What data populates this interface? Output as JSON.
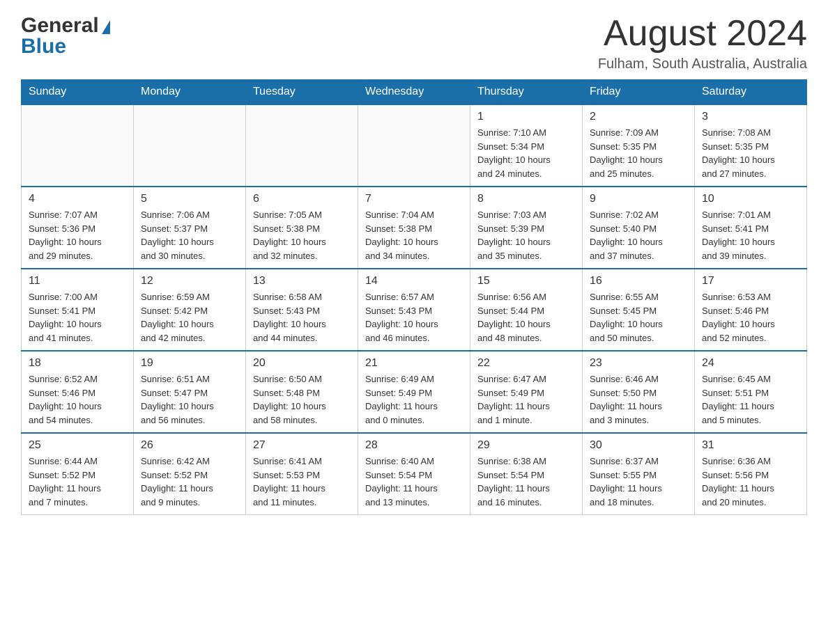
{
  "header": {
    "month_title": "August 2024",
    "location": "Fulham, South Australia, Australia",
    "logo_general": "General",
    "logo_blue": "Blue"
  },
  "weekdays": [
    "Sunday",
    "Monday",
    "Tuesday",
    "Wednesday",
    "Thursday",
    "Friday",
    "Saturday"
  ],
  "weeks": [
    {
      "days": [
        {
          "number": "",
          "info": ""
        },
        {
          "number": "",
          "info": ""
        },
        {
          "number": "",
          "info": ""
        },
        {
          "number": "",
          "info": ""
        },
        {
          "number": "1",
          "info": "Sunrise: 7:10 AM\nSunset: 5:34 PM\nDaylight: 10 hours\nand 24 minutes."
        },
        {
          "number": "2",
          "info": "Sunrise: 7:09 AM\nSunset: 5:35 PM\nDaylight: 10 hours\nand 25 minutes."
        },
        {
          "number": "3",
          "info": "Sunrise: 7:08 AM\nSunset: 5:35 PM\nDaylight: 10 hours\nand 27 minutes."
        }
      ]
    },
    {
      "days": [
        {
          "number": "4",
          "info": "Sunrise: 7:07 AM\nSunset: 5:36 PM\nDaylight: 10 hours\nand 29 minutes."
        },
        {
          "number": "5",
          "info": "Sunrise: 7:06 AM\nSunset: 5:37 PM\nDaylight: 10 hours\nand 30 minutes."
        },
        {
          "number": "6",
          "info": "Sunrise: 7:05 AM\nSunset: 5:38 PM\nDaylight: 10 hours\nand 32 minutes."
        },
        {
          "number": "7",
          "info": "Sunrise: 7:04 AM\nSunset: 5:38 PM\nDaylight: 10 hours\nand 34 minutes."
        },
        {
          "number": "8",
          "info": "Sunrise: 7:03 AM\nSunset: 5:39 PM\nDaylight: 10 hours\nand 35 minutes."
        },
        {
          "number": "9",
          "info": "Sunrise: 7:02 AM\nSunset: 5:40 PM\nDaylight: 10 hours\nand 37 minutes."
        },
        {
          "number": "10",
          "info": "Sunrise: 7:01 AM\nSunset: 5:41 PM\nDaylight: 10 hours\nand 39 minutes."
        }
      ]
    },
    {
      "days": [
        {
          "number": "11",
          "info": "Sunrise: 7:00 AM\nSunset: 5:41 PM\nDaylight: 10 hours\nand 41 minutes."
        },
        {
          "number": "12",
          "info": "Sunrise: 6:59 AM\nSunset: 5:42 PM\nDaylight: 10 hours\nand 42 minutes."
        },
        {
          "number": "13",
          "info": "Sunrise: 6:58 AM\nSunset: 5:43 PM\nDaylight: 10 hours\nand 44 minutes."
        },
        {
          "number": "14",
          "info": "Sunrise: 6:57 AM\nSunset: 5:43 PM\nDaylight: 10 hours\nand 46 minutes."
        },
        {
          "number": "15",
          "info": "Sunrise: 6:56 AM\nSunset: 5:44 PM\nDaylight: 10 hours\nand 48 minutes."
        },
        {
          "number": "16",
          "info": "Sunrise: 6:55 AM\nSunset: 5:45 PM\nDaylight: 10 hours\nand 50 minutes."
        },
        {
          "number": "17",
          "info": "Sunrise: 6:53 AM\nSunset: 5:46 PM\nDaylight: 10 hours\nand 52 minutes."
        }
      ]
    },
    {
      "days": [
        {
          "number": "18",
          "info": "Sunrise: 6:52 AM\nSunset: 5:46 PM\nDaylight: 10 hours\nand 54 minutes."
        },
        {
          "number": "19",
          "info": "Sunrise: 6:51 AM\nSunset: 5:47 PM\nDaylight: 10 hours\nand 56 minutes."
        },
        {
          "number": "20",
          "info": "Sunrise: 6:50 AM\nSunset: 5:48 PM\nDaylight: 10 hours\nand 58 minutes."
        },
        {
          "number": "21",
          "info": "Sunrise: 6:49 AM\nSunset: 5:49 PM\nDaylight: 11 hours\nand 0 minutes."
        },
        {
          "number": "22",
          "info": "Sunrise: 6:47 AM\nSunset: 5:49 PM\nDaylight: 11 hours\nand 1 minute."
        },
        {
          "number": "23",
          "info": "Sunrise: 6:46 AM\nSunset: 5:50 PM\nDaylight: 11 hours\nand 3 minutes."
        },
        {
          "number": "24",
          "info": "Sunrise: 6:45 AM\nSunset: 5:51 PM\nDaylight: 11 hours\nand 5 minutes."
        }
      ]
    },
    {
      "days": [
        {
          "number": "25",
          "info": "Sunrise: 6:44 AM\nSunset: 5:52 PM\nDaylight: 11 hours\nand 7 minutes."
        },
        {
          "number": "26",
          "info": "Sunrise: 6:42 AM\nSunset: 5:52 PM\nDaylight: 11 hours\nand 9 minutes."
        },
        {
          "number": "27",
          "info": "Sunrise: 6:41 AM\nSunset: 5:53 PM\nDaylight: 11 hours\nand 11 minutes."
        },
        {
          "number": "28",
          "info": "Sunrise: 6:40 AM\nSunset: 5:54 PM\nDaylight: 11 hours\nand 13 minutes."
        },
        {
          "number": "29",
          "info": "Sunrise: 6:38 AM\nSunset: 5:54 PM\nDaylight: 11 hours\nand 16 minutes."
        },
        {
          "number": "30",
          "info": "Sunrise: 6:37 AM\nSunset: 5:55 PM\nDaylight: 11 hours\nand 18 minutes."
        },
        {
          "number": "31",
          "info": "Sunrise: 6:36 AM\nSunset: 5:56 PM\nDaylight: 11 hours\nand 20 minutes."
        }
      ]
    }
  ]
}
